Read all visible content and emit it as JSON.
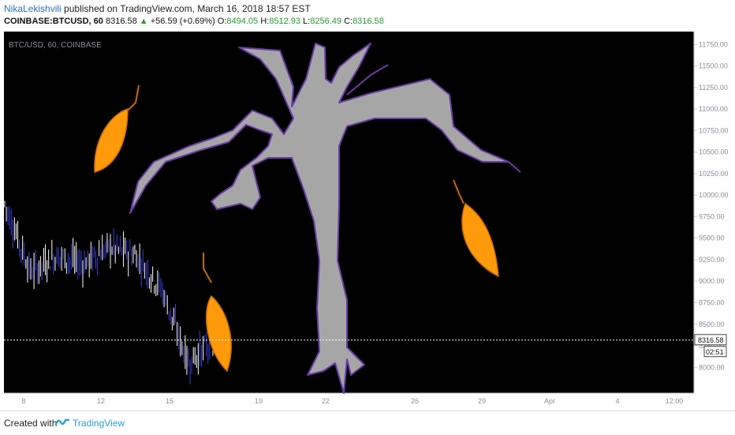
{
  "header": {
    "author": "NikaLekishvili",
    "published_text": "published on TradingView.com, March 16, 2018 18:57 EST",
    "symbol": "COINBASE:BTCUSD, 60",
    "last": "8316.58",
    "change": "+56.59 (+0.69%)",
    "o_label": "O:",
    "o_value": "8494.05",
    "h_label": "H:",
    "h_value": "8512.93",
    "l_label": "L:",
    "l_value": "8256.49",
    "c_label": "C:",
    "c_value": "8316.58"
  },
  "watermark": "BTC/USD, 60, COINBASE",
  "price_label": "8316.58",
  "countdown": "02:51",
  "footer": {
    "created": "Created with",
    "brand": "TradingView"
  },
  "colors": {
    "background": "#000000",
    "price_axis_bg": "#ffffff",
    "candle": "#ffffff",
    "candle_down": "#3a3fd6",
    "tree": "#a6a6a6",
    "tree_outline": "#6a3aa8",
    "leaf": "#ff9a0a",
    "leaf_stem": "#c8690a",
    "accent": "#2a6fc4",
    "positive": "#22a02c"
  },
  "chart_data": {
    "type": "line",
    "title": "BTC/USD, 60, COINBASE",
    "ylim": [
      7700,
      11900
    ],
    "y_ticks": [
      8000,
      8250,
      8500,
      8750,
      9000,
      9250,
      9500,
      9750,
      10000,
      10250,
      10500,
      10750,
      11000,
      11250,
      11500,
      11750
    ],
    "y_tick_labels": [
      "8000.00",
      "8250.00",
      "8500.00",
      "8750.00",
      "9000.00",
      "9250.00",
      "9500.00",
      "9750.00",
      "10000.00",
      "10250.00",
      "10500.00",
      "10750.00",
      "11000.00",
      "11250.00",
      "11500.00",
      "11750.00"
    ],
    "x_ticks": [
      "8",
      "12",
      "15",
      "19",
      "22",
      "26",
      "29",
      "Apr",
      "4",
      "12:00"
    ],
    "last_price": 8316.58,
    "series": [
      {
        "x": [
          "Mar 8",
          "Mar 9",
          "Mar 10",
          "Mar 11",
          "Mar 12",
          "Mar 13",
          "Mar 14",
          "Mar 15",
          "Mar 16"
        ],
        "values": [
          9900,
          9100,
          9300,
          9200,
          9400,
          9300,
          8900,
          8050,
          8320
        ]
      }
    ],
    "grid": false
  }
}
